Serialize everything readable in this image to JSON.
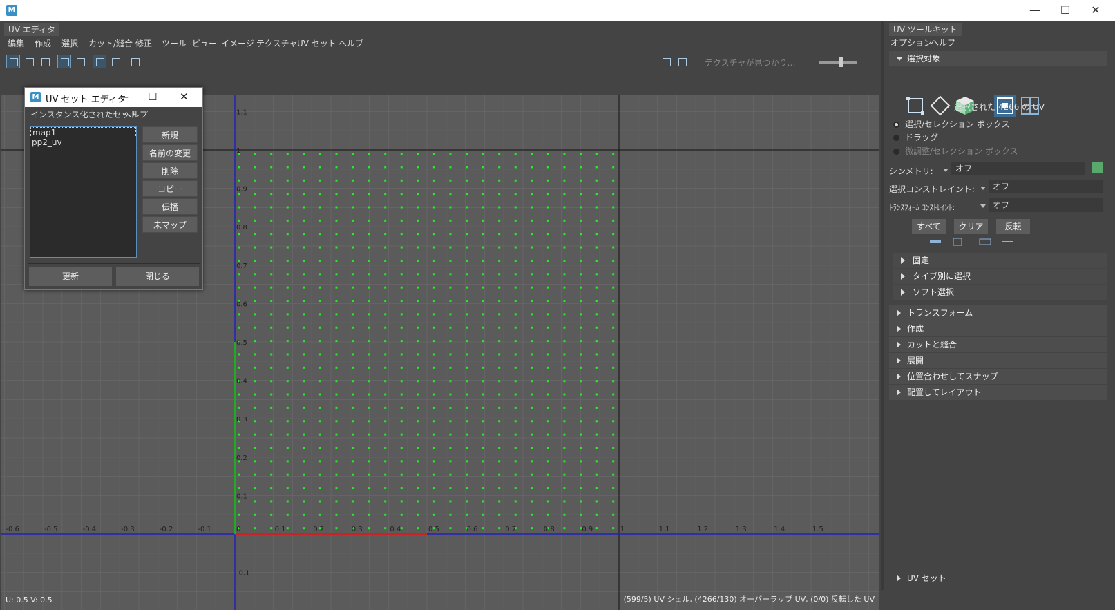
{
  "window": {
    "close": "✕",
    "maximize": "☐",
    "minimize": "—",
    "logo": "M"
  },
  "uv_editor": {
    "tab": "UV エディタ",
    "menus": [
      "編集",
      "作成",
      "選択",
      "カット/縫合",
      "修正",
      "ツール",
      "ビュー",
      "イメージ",
      "テクスチャ",
      "UV セット",
      "ヘルプ"
    ],
    "texture_missing": "テクスチャが見つかり…",
    "status_left": "U:  0.5 V:  0.5",
    "status_right": "(599/5) UV シェル, (4266/130) オーバーラップ UV, (0/0) 反転した UV",
    "x_ticks": [
      "-0.6",
      "-0.5",
      "-0.4",
      "-0.3",
      "-0.2",
      "-0.1",
      "0",
      "0.1",
      "0.2",
      "0.3",
      "0.4",
      "0.5",
      "0.6",
      "0.7",
      "0.8",
      "0.9",
      "1",
      "1.1",
      "1.2",
      "1.3",
      "1.4",
      "1.5"
    ],
    "y_ticks": [
      "1.1",
      "1",
      "0.9",
      "0.8",
      "0.7",
      "0.6",
      "0.5",
      "0.4",
      "0.3",
      "0.2",
      "0.1",
      "-0.1"
    ],
    "uv_point_color": "#22ee22"
  },
  "uvset_dialog": {
    "title": "UV セット エディタ",
    "menus": [
      "インスタンス化されたセット",
      "ヘルプ"
    ],
    "sets": [
      "map1",
      "pp2_uv"
    ],
    "buttons": [
      "新規",
      "名前の変更",
      "削除",
      "コピー",
      "伝播",
      "未マップ"
    ],
    "update": "更新",
    "close": "閉じる"
  },
  "toolkit": {
    "tab": "UV ツールキット",
    "menus": [
      "オプション",
      "ヘルプ"
    ],
    "selection_header": "選択対象",
    "selected_count": "選択された 4266 の UV",
    "radio_options": [
      "選択/セレクション ボックス",
      "ドラッグ",
      "微調整/セレクション ボックス"
    ],
    "symmetry_label": "シンメトリ:",
    "symmetry_value": "オフ",
    "select_constraint_label": "選択コンストレイント:",
    "select_constraint_value": "オフ",
    "transform_constraint_label": "ﾄﾗﾝｽﾌｫｰﾑ ｺﾝｽﾄﾚｲﾝﾄ:",
    "transform_constraint_value": "オフ",
    "buttons": [
      "すべて",
      "クリア",
      "反転"
    ],
    "subsections": [
      "固定",
      "タイプ別に選択",
      "ソフト選択"
    ],
    "sections": [
      "トランスフォーム",
      "作成",
      "カットと縫合",
      "展開",
      "位置合わせしてスナップ",
      "配置してレイアウト"
    ],
    "bottom_section": "UV セット"
  }
}
